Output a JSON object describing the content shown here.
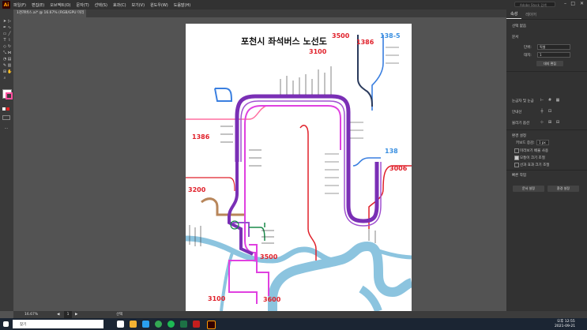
{
  "app": {
    "icon_label": "Ai",
    "menu": [
      "파일(F)",
      "편집(E)",
      "오브젝트(O)",
      "문자(T)",
      "선택(S)",
      "효과(C)",
      "보기(V)",
      "윈도우(W)",
      "도움말(H)"
    ],
    "search_placeholder": "Adobe Stock 검색",
    "doc_tab": "1천까버스.ai* @ 16.67% (RGB/GPU 미리 보기)"
  },
  "map": {
    "title": "포천시 좌석버스 노선도",
    "route_labels": [
      "3500",
      "1386",
      "138-5",
      "3100",
      "1386",
      "138",
      "3006",
      "3200",
      "3500",
      "3100",
      "3600"
    ],
    "colors": {
      "purple": "#7a2fb5",
      "magenta": "#e040e0",
      "navy": "#2a3a5c",
      "blue": "#3a7fe0",
      "pink": "#ff6fa0",
      "red": "#e0202a",
      "green": "#1a8a4a",
      "tan": "#b8865a",
      "river": "#8cc4df",
      "label_red": "#e0202a",
      "label_blue": "#3a8fe0"
    }
  },
  "panel": {
    "tabs": [
      "속성",
      "레이어"
    ],
    "no_selection": "선택 없음",
    "doc_section": "문서",
    "units_label": "단위:",
    "units_value": "픽셀",
    "artboard_label": "대지:",
    "artboard_value": "1",
    "doc_setup_button": "대지 편집",
    "ruler_grid": "눈금자 및 눈금",
    "guides": "안내선",
    "snap": "물리기 옵션",
    "prefs_section": "환경 설정",
    "keyboard_increment_label": "키보드 증감:",
    "keyboard_increment_value": "1 px",
    "check1": "미리보기 배율 사용",
    "check2": "모퉁이 크기 조절",
    "check3": "선과 효과 크기 조절",
    "quick_actions": "빠른 작업",
    "doc_settings_button": "문서 설정",
    "prefs_button": "환경 설정"
  },
  "status": {
    "zoom": "16.67%",
    "page": "1",
    "tool": "선택"
  },
  "taskbar": {
    "search_placeholder": "찾기",
    "time": "오후 12:55",
    "date": "2021-09-21"
  }
}
